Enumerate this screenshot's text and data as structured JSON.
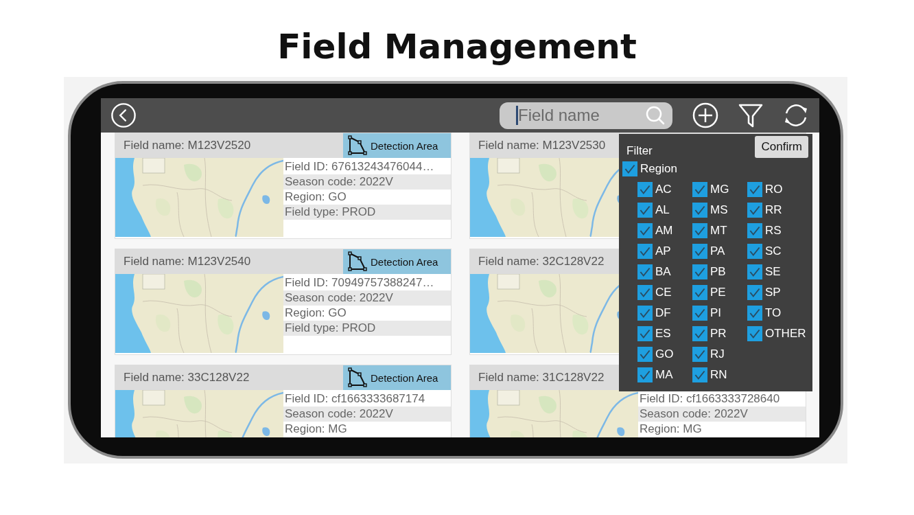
{
  "title": "Field Management",
  "search": {
    "placeholder": "Field name"
  },
  "cards": [
    {
      "title": "Field name: M123V2520",
      "action": "Detection Area",
      "details": [
        "Field ID: 67613243476044…",
        "Season code: 2022V",
        "Region: GO",
        "Field type: PROD"
      ]
    },
    {
      "title": "Field name: M123V2530"
    },
    {
      "title": "Field name: M123V2540",
      "action": "Detection Area",
      "details": [
        "Field ID: 70949757388247…",
        "Season code: 2022V",
        "Region: GO",
        "Field type: PROD"
      ]
    },
    {
      "title": "Field name: 32C128V22"
    },
    {
      "title": "Field name: 33C128V22",
      "action": "Detection Area",
      "details": [
        "Field ID: cf1663333687174",
        "Season code: 2022V",
        "Region: MG"
      ]
    },
    {
      "title": "Field name: 31C128V22",
      "details": [
        "Field ID: cf1663333728640",
        "Season code: 2022V",
        "Region: MG"
      ]
    }
  ],
  "filter": {
    "title": "Filter",
    "confirm": "Confirm",
    "group": {
      "label": "Region",
      "checked": true
    },
    "options": [
      {
        "label": "AC",
        "checked": true
      },
      {
        "label": "AL",
        "checked": true
      },
      {
        "label": "AM",
        "checked": true
      },
      {
        "label": "AP",
        "checked": true
      },
      {
        "label": "BA",
        "checked": true
      },
      {
        "label": "CE",
        "checked": true
      },
      {
        "label": "DF",
        "checked": true
      },
      {
        "label": "ES",
        "checked": true
      },
      {
        "label": "GO",
        "checked": true
      },
      {
        "label": "MA",
        "checked": true
      },
      {
        "label": "MG",
        "checked": true
      },
      {
        "label": "MS",
        "checked": true
      },
      {
        "label": "MT",
        "checked": true
      },
      {
        "label": "PA",
        "checked": true
      },
      {
        "label": "PB",
        "checked": true
      },
      {
        "label": "PE",
        "checked": true
      },
      {
        "label": "PI",
        "checked": true
      },
      {
        "label": "PR",
        "checked": true
      },
      {
        "label": "RJ",
        "checked": true
      },
      {
        "label": "RN",
        "checked": true
      },
      {
        "label": "RO",
        "checked": true
      },
      {
        "label": "RR",
        "checked": true
      },
      {
        "label": "RS",
        "checked": true
      },
      {
        "label": "SC",
        "checked": true
      },
      {
        "label": "SE",
        "checked": true
      },
      {
        "label": "SP",
        "checked": true
      },
      {
        "label": "TO",
        "checked": true
      },
      {
        "label": "OTHER",
        "checked": true
      }
    ]
  }
}
